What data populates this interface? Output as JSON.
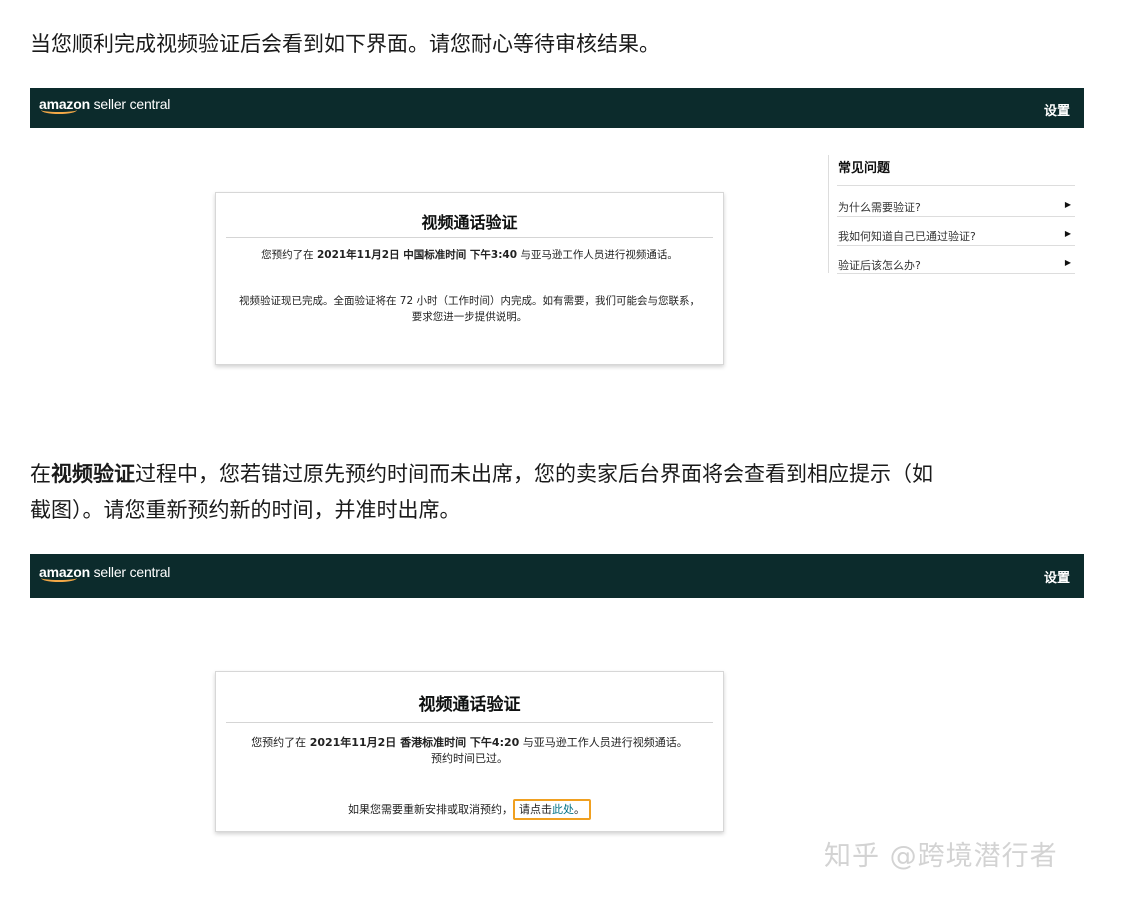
{
  "intro_text": "当您顺利完成视频验证后会看到如下界面。请您耐心等待审核结果。",
  "screen1": {
    "logo_brand": "amazon",
    "logo_rest": " seller central",
    "settings": "设置",
    "card_title": "视频通话验证",
    "appt_pre": "您预约了在 ",
    "appt_bold": "2021年11月2日 中国标准时间 下午3:40",
    "appt_post": " 与亚马逊工作人员进行视频通话。",
    "done_line1": "视频验证现已完成。全面验证将在 72 小时（工作时间）内完成。如有需要，我们可能会与您联系，",
    "done_line2": "要求您进一步提供说明。",
    "faq": {
      "title": "常见问题",
      "items": [
        {
          "label": "为什么需要验证?"
        },
        {
          "label": "我如何知道自己已通过验证?"
        },
        {
          "label": "验证后该怎么办?"
        }
      ]
    }
  },
  "middle_text": {
    "pre": "在",
    "bold": "视频验证",
    "line1_rest": "过程中，您若错过原先预约时间而未出席，您的卖家后台界面将会查看到相应提示（如",
    "line2": "截图）。请您重新预约新的时间，并准时出席。"
  },
  "screen2": {
    "logo_brand": "amazon",
    "logo_rest": " seller central",
    "settings": "设置",
    "card_title": "视频通话验证",
    "appt_pre": "您预约了在 ",
    "appt_bold": "2021年11月2日 香港标准时间 下午4:20",
    "appt_post": " 与亚马逊工作人员进行视频通话。",
    "appt_line2": "预约时间已过。",
    "resched_pre": "如果您需要重新安排或取消预约，",
    "resched_click": "请点击",
    "resched_link": "此处",
    "resched_end": "。"
  },
  "watermark": "知乎 @跨境潜行者",
  "colors": {
    "topbar": "#0c2b2c",
    "link": "#007185",
    "highlight": "#f0a020",
    "smile": "#f3a847"
  }
}
